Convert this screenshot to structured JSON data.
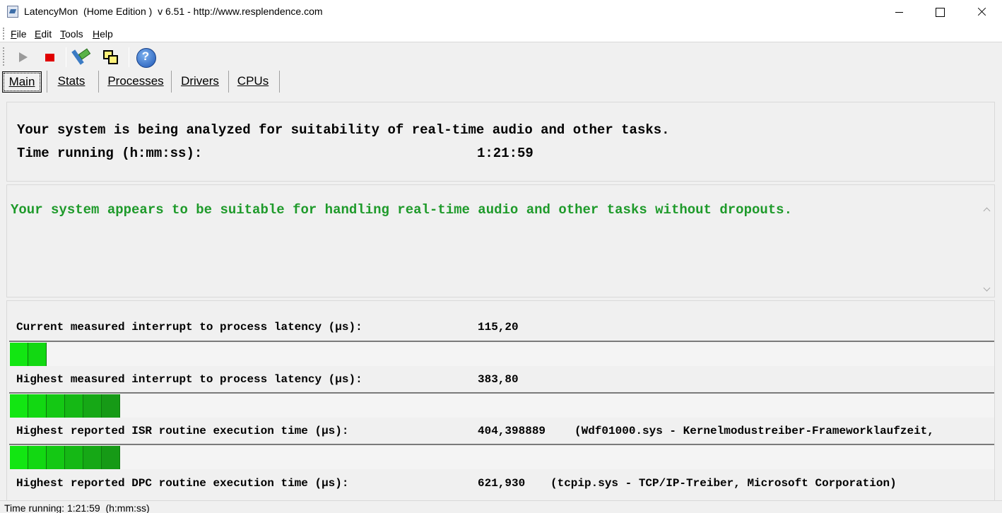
{
  "window": {
    "title": "LatencyMon  (Home Edition )  v 6.51 - http://www.resplendence.com"
  },
  "menu": [
    {
      "label": "File",
      "underline": "F",
      "rest": "ile"
    },
    {
      "label": "Edit",
      "underline": "E",
      "rest": "dit"
    },
    {
      "label": "Tools",
      "underline": "T",
      "rest": "ools"
    },
    {
      "label": "Help",
      "underline": "H",
      "rest": "elp"
    }
  ],
  "toolbar": {
    "icons": [
      "play-icon",
      "stop-icon",
      "hammer-icon",
      "windows-icon",
      "help-icon"
    ],
    "help_glyph": "?"
  },
  "tabs": [
    {
      "label": "Main",
      "active": true
    },
    {
      "label": "Stats",
      "active": false
    },
    {
      "label": "Processes",
      "active": false
    },
    {
      "label": "Drivers",
      "active": false
    },
    {
      "label": "CPUs",
      "active": false
    }
  ],
  "status_panel": {
    "line1": "Your system is being analyzed for suitability of real-time audio and other tasks.",
    "time_label": "Time running (h:mm:ss):",
    "time_value": "1:21:59"
  },
  "verdict": {
    "text": "Your system appears to be suitable for handling real-time audio and other tasks without dropouts.",
    "color": "#1e9a2a"
  },
  "measurements": [
    {
      "label": "Current measured interrupt to process latency (µs):",
      "value": "115,20",
      "detail": "",
      "bar_segments": 2
    },
    {
      "label": "Highest measured interrupt to process latency (µs):",
      "value": "383,80",
      "detail": "",
      "bar_segments": 6
    },
    {
      "label": "Highest reported ISR routine execution time (µs):",
      "value": "404,398889",
      "detail": "(Wdf01000.sys - Kernelmodustreiber-Frameworklaufzeit,",
      "bar_segments": 6
    },
    {
      "label": "Highest reported DPC routine execution time (µs):",
      "value": "621,930",
      "detail": "(tcpip.sys - TCP/IP-Treiber, Microsoft Corporation)",
      "bar_segments": 0
    }
  ],
  "bar_colors": [
    "#12e612",
    "#12d812",
    "#14c814",
    "#15b815",
    "#16a816",
    "#169a16"
  ],
  "statusbar": {
    "text": "Time running: 1:21:59  (h:mm:ss)"
  }
}
